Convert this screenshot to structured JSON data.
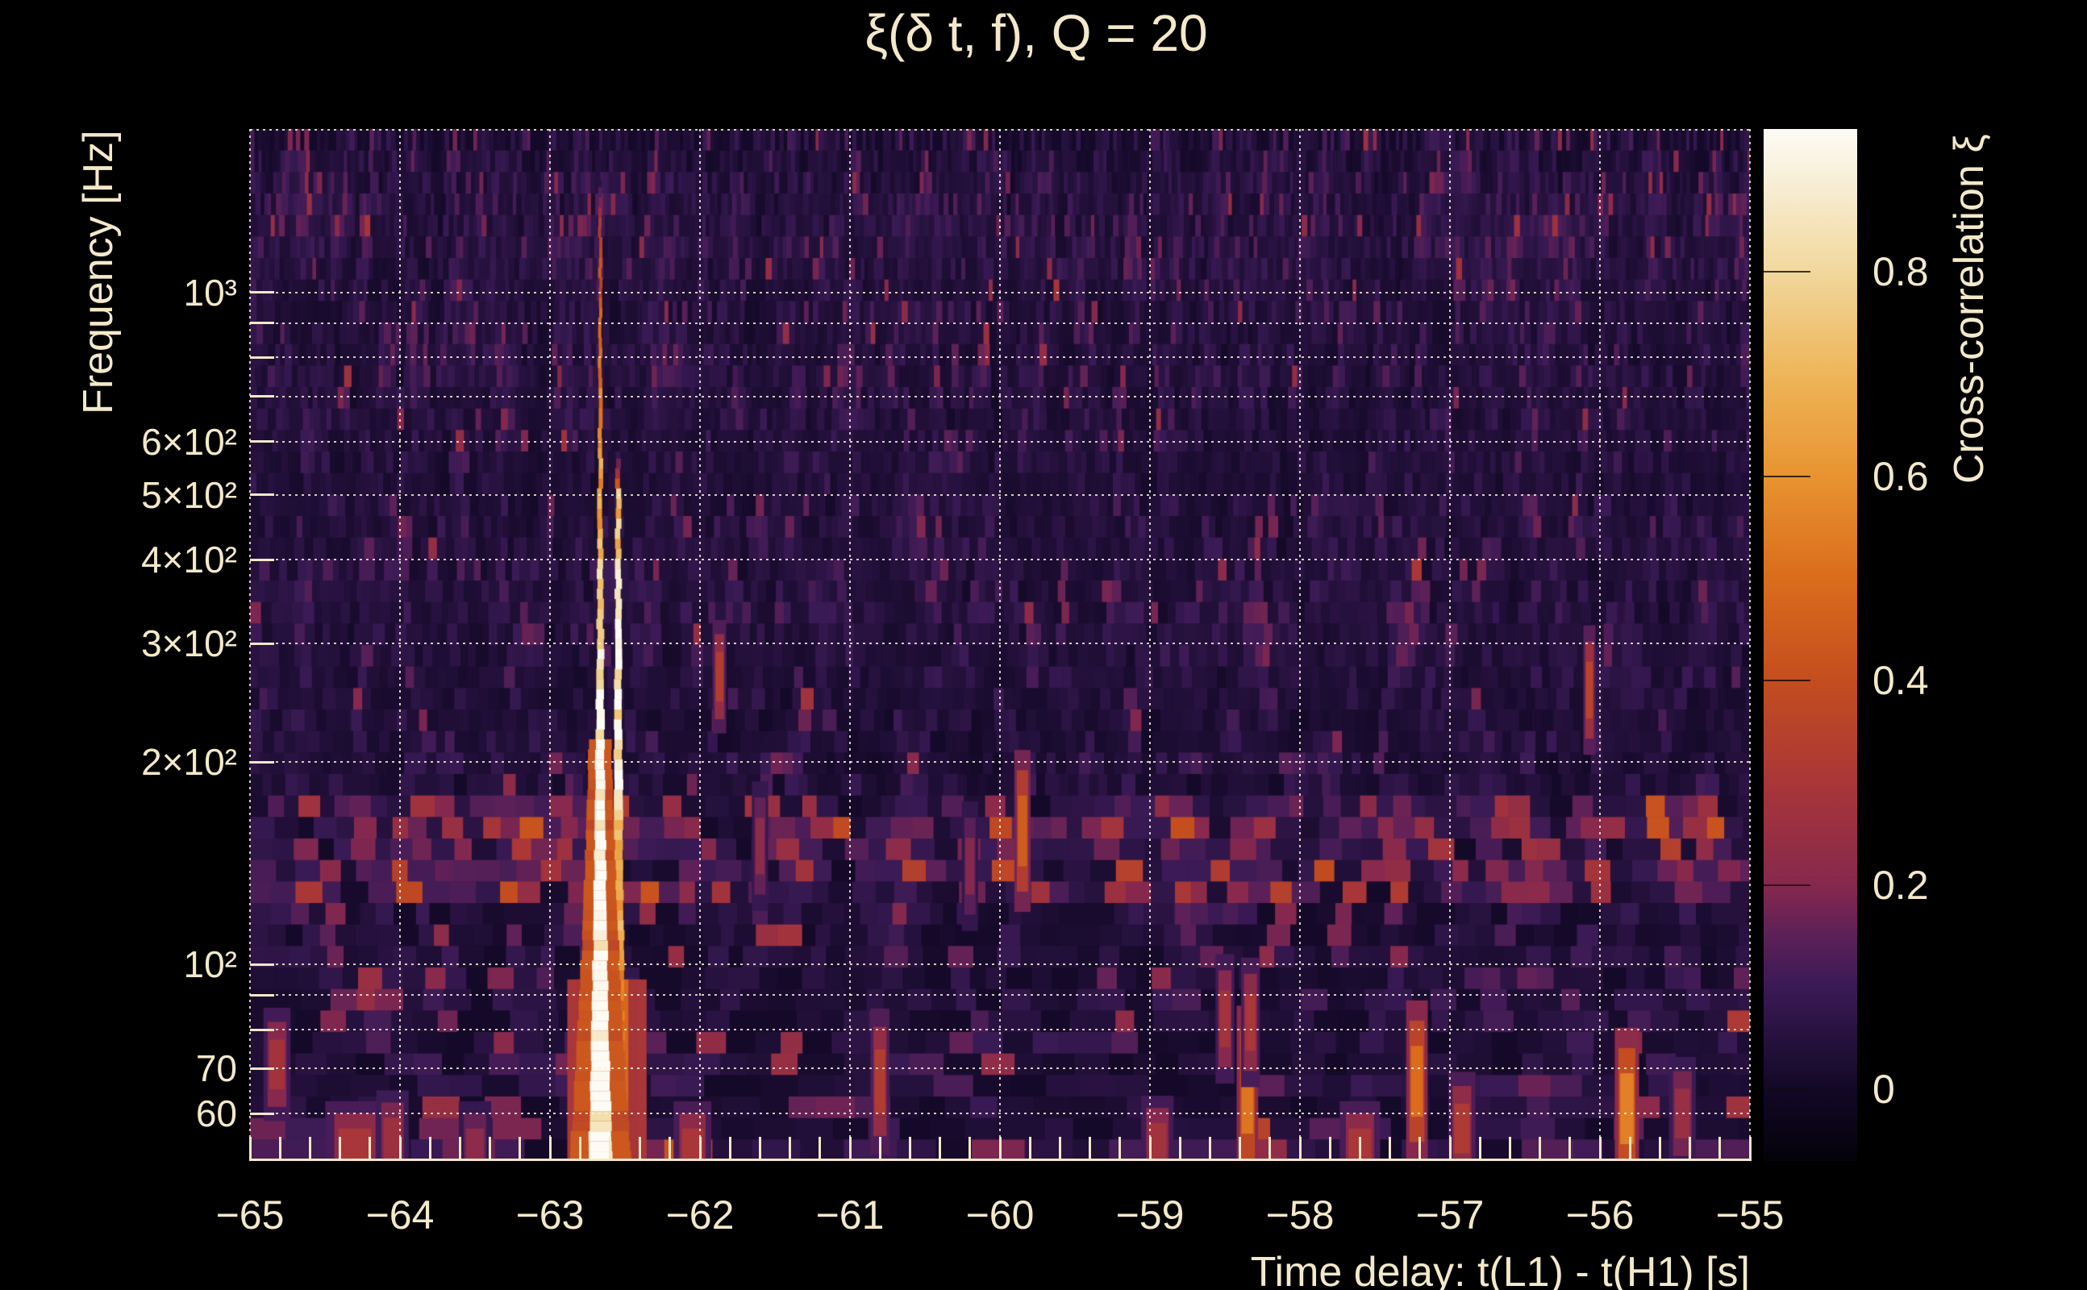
{
  "figure": {
    "background": "#000000",
    "text_color": "#f3e9c9"
  },
  "chart_data": {
    "type": "heatmap",
    "title": "ξ(δ t, f), Q = 20",
    "xlabel": "Time delay: t(L1) - t(H1) [s]",
    "ylabel": "Frequency [Hz]",
    "colorbar_label": "Cross-correlation ξ",
    "x_range": [
      -65,
      -55
    ],
    "x_tick_step": 1,
    "x_minor_tick_step": 0.2,
    "x_tick_labels": [
      "−65",
      "−64",
      "−63",
      "−62",
      "−61",
      "−60",
      "−59",
      "−58",
      "−57",
      "−56",
      "−55"
    ],
    "y_scale": "log",
    "y_range_hz": [
      51,
      1750
    ],
    "y_ticks": [
      {
        "f": 1000,
        "label": "10³"
      },
      {
        "f": 600,
        "label": "6×10²"
      },
      {
        "f": 500,
        "label": "5×10²"
      },
      {
        "f": 400,
        "label": "4×10²"
      },
      {
        "f": 300,
        "label": "3×10²"
      },
      {
        "f": 200,
        "label": "2×10²"
      },
      {
        "f": 100,
        "label": "10²"
      },
      {
        "f": 70,
        "label": "70"
      },
      {
        "f": 60,
        "label": "60"
      }
    ],
    "y_grid_hz": [
      60,
      70,
      80,
      90,
      100,
      200,
      300,
      400,
      500,
      600,
      700,
      800,
      900,
      1000
    ],
    "grid": true,
    "color_scale": {
      "range": [
        -0.07,
        0.94
      ],
      "ticks": [
        {
          "v": 0.8,
          "label": "0.8"
        },
        {
          "v": 0.6,
          "label": "0.6"
        },
        {
          "v": 0.4,
          "label": "0.4"
        },
        {
          "v": 0.2,
          "label": "0.2"
        },
        {
          "v": 0.0,
          "label": "0"
        }
      ],
      "stops": [
        [
          0.0,
          "#04020a"
        ],
        [
          0.069,
          "#120826"
        ],
        [
          0.168,
          "#3a1a55"
        ],
        [
          0.218,
          "#5c2058"
        ],
        [
          0.267,
          "#86284e"
        ],
        [
          0.366,
          "#a93638"
        ],
        [
          0.465,
          "#c44d1f"
        ],
        [
          0.564,
          "#da6c1c"
        ],
        [
          0.663,
          "#e89330"
        ],
        [
          0.762,
          "#eeb559"
        ],
        [
          0.861,
          "#f1d79c"
        ],
        [
          0.96,
          "#f9f1dd"
        ],
        [
          1.0,
          "#fdfbf4"
        ]
      ]
    },
    "noise_floor": {
      "seed": 1234,
      "base_xi": 0.02,
      "bands": [
        {
          "f_lo": 1000,
          "f_hi": 1750,
          "mean_xi": 0.062,
          "width_scale": 1.0
        },
        {
          "f_lo": 700,
          "f_hi": 1000,
          "mean_xi": 0.058,
          "width_scale": 1.0
        },
        {
          "f_lo": 420,
          "f_hi": 700,
          "mean_xi": 0.05,
          "width_scale": 1.0
        },
        {
          "f_lo": 260,
          "f_hi": 420,
          "mean_xi": 0.052,
          "width_scale": 1.0
        },
        {
          "f_lo": 185,
          "f_hi": 260,
          "mean_xi": 0.046,
          "width_scale": 1.0
        },
        {
          "f_lo": 125,
          "f_hi": 185,
          "mean_xi": 0.105,
          "width_scale": 1.5
        },
        {
          "f_lo": 95,
          "f_hi": 125,
          "mean_xi": 0.055,
          "width_scale": 1.2
        },
        {
          "f_lo": 75,
          "f_hi": 95,
          "mean_xi": 0.046,
          "width_scale": 1.3
        },
        {
          "f_lo": 58,
          "f_hi": 75,
          "mean_xi": 0.068,
          "width_scale": 1.5
        },
        {
          "f_lo": 51,
          "f_hi": 58,
          "mean_xi": 0.085,
          "width_scale": 1.8
        }
      ]
    },
    "features": {
      "primary_streak": {
        "t": -62.665,
        "f_lo": 51,
        "f_hi": 1470,
        "xi_max": 0.96
      },
      "secondary_streak": {
        "t": -62.545,
        "f_lo": 51,
        "f_hi": 580,
        "xi_max": 0.88
      },
      "low_f_cluster": {
        "t_lo": -62.82,
        "t_hi": -62.42,
        "f_lo": 51,
        "f_hi": 95,
        "xi_max": 0.97,
        "slice_xi": [
          0.3,
          0.5,
          0.8,
          0.97,
          0.8,
          0.5,
          0.3
        ]
      },
      "blobs": [
        [
          -64.82,
          71,
          0.28,
          0.1,
          0.35
        ],
        [
          -64.3,
          53,
          0.3,
          0.22,
          0.3
        ],
        [
          -64.05,
          55,
          0.26,
          0.12,
          0.3
        ],
        [
          -63.5,
          53,
          0.22,
          0.12,
          0.3
        ],
        [
          -62.05,
          53,
          0.3,
          0.14,
          0.3
        ],
        [
          -61.87,
          268,
          0.33,
          0.05,
          0.35
        ],
        [
          -61.6,
          150,
          0.22,
          0.06,
          0.4
        ],
        [
          -60.8,
          67,
          0.33,
          0.07,
          0.45
        ],
        [
          -60.2,
          140,
          0.2,
          0.06,
          0.4
        ],
        [
          -59.85,
          158,
          0.45,
          0.06,
          0.5
        ],
        [
          -58.95,
          54,
          0.28,
          0.12,
          0.3
        ],
        [
          -58.5,
          83,
          0.28,
          0.07,
          0.4
        ],
        [
          -58.35,
          64,
          0.52,
          0.08,
          0.55
        ],
        [
          -58.33,
          82,
          0.3,
          0.07,
          0.4
        ],
        [
          -57.6,
          53,
          0.3,
          0.15,
          0.3
        ],
        [
          -57.22,
          67,
          0.5,
          0.08,
          0.5
        ],
        [
          -56.92,
          57,
          0.32,
          0.1,
          0.35
        ],
        [
          -56.07,
          256,
          0.36,
          0.045,
          0.4
        ],
        [
          -55.82,
          61,
          0.55,
          0.09,
          0.5
        ],
        [
          -55.45,
          60,
          0.25,
          0.1,
          0.35
        ]
      ]
    }
  }
}
